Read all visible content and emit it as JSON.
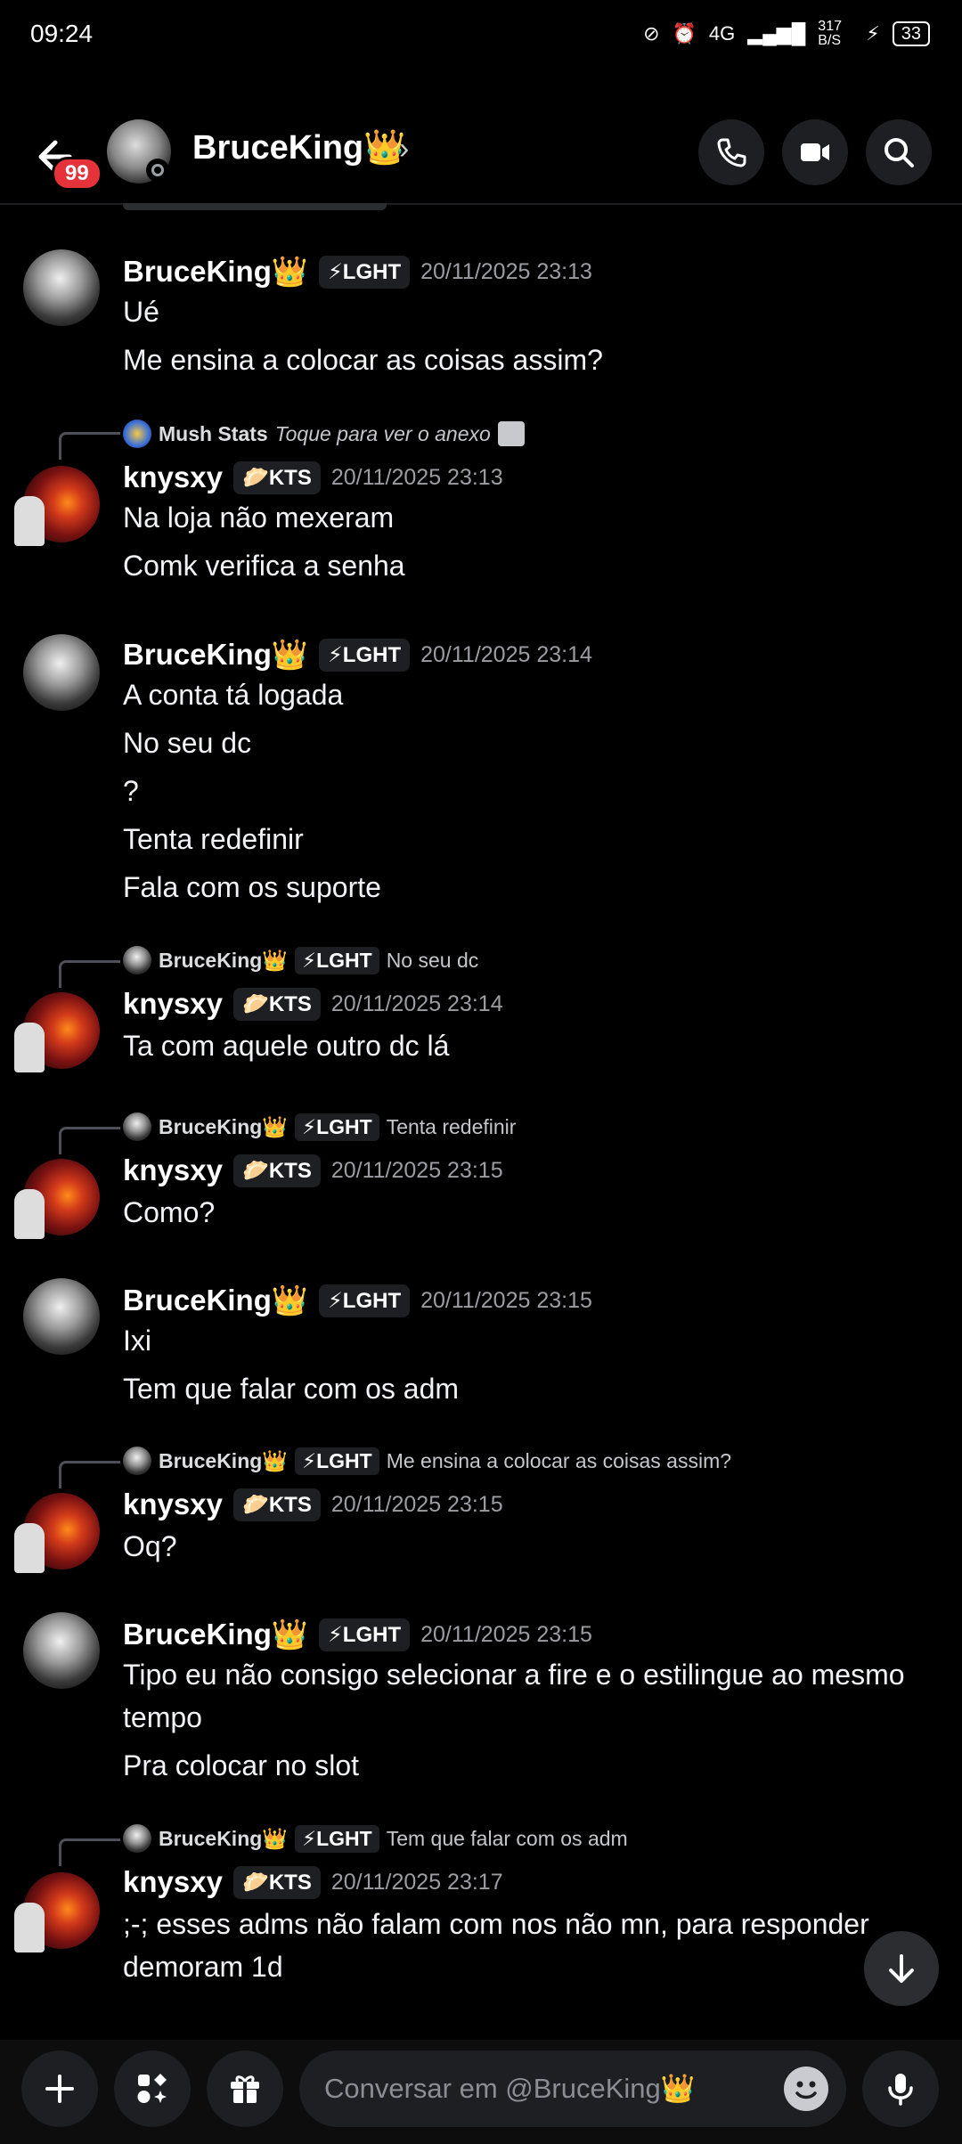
{
  "status_bar": {
    "time": "09:24",
    "signal": "4G",
    "speed": "317 B/S",
    "battery": "33"
  },
  "header": {
    "back_badge": "99",
    "name": "BruceKing👑",
    "chevron": "›"
  },
  "tags": {
    "bruce": "⚡LGHT",
    "knysxy": "🥟KTS"
  },
  "messages": [
    {
      "author": "BruceKing👑",
      "tag": "⚡LGHT",
      "timestamp": "20/11/2025 23:13",
      "lines": [
        "Ué",
        "Me ensina a colocar as coisas assim?"
      ]
    },
    {
      "reply": {
        "name": "Mush Stats",
        "text": "Toque para ver o anexo"
      },
      "author": "knysxy",
      "tag": "🥟KTS",
      "timestamp": "20/11/2025 23:13",
      "lines": [
        "Na loja não mexeram",
        "Comk verifica a senha"
      ]
    },
    {
      "author": "BruceKing👑",
      "tag": "⚡LGHT",
      "timestamp": "20/11/2025 23:14",
      "lines": [
        "A conta tá logada",
        "No seu dc",
        "?",
        "Tenta redefinir",
        "Fala com os suporte"
      ]
    },
    {
      "reply": {
        "name": "BruceKing👑",
        "tag": "⚡LGHT",
        "text": "No seu dc"
      },
      "author": "knysxy",
      "tag": "🥟KTS",
      "timestamp": "20/11/2025 23:14",
      "lines": [
        "Ta com aquele outro dc lá"
      ]
    },
    {
      "reply": {
        "name": "BruceKing👑",
        "tag": "⚡LGHT",
        "text": "Tenta redefinir"
      },
      "author": "knysxy",
      "tag": "🥟KTS",
      "timestamp": "20/11/2025 23:15",
      "lines": [
        "Como?"
      ]
    },
    {
      "author": "BruceKing👑",
      "tag": "⚡LGHT",
      "timestamp": "20/11/2025 23:15",
      "lines": [
        "Ixi",
        "Tem que falar com os adm"
      ]
    },
    {
      "reply": {
        "name": "BruceKing👑",
        "tag": "⚡LGHT",
        "text": "Me ensina a colocar as coisas assim?"
      },
      "author": "knysxy",
      "tag": "🥟KTS",
      "timestamp": "20/11/2025 23:15",
      "lines": [
        "Oq?"
      ]
    },
    {
      "author": "BruceKing👑",
      "tag": "⚡LGHT",
      "timestamp": "20/11/2025 23:15",
      "lines": [
        "Tipo eu não consigo selecionar a fire e o estilingue ao mesmo tempo",
        "Pra colocar no slot"
      ]
    },
    {
      "reply": {
        "name": "BruceKing👑",
        "tag": "⚡LGHT",
        "text": "Tem que falar com os adm"
      },
      "author": "knysxy",
      "tag": "🥟KTS",
      "timestamp": "20/11/2025 23:17",
      "lines": [
        ";-; esses adms não falam com nos não mn, para responder demoram 1d"
      ]
    }
  ],
  "composer": {
    "placeholder": "Conversar em @BruceKing👑"
  },
  "icons": {
    "back": "arrow-left-icon",
    "call": "phone-icon",
    "video": "video-icon",
    "search": "search-icon",
    "scroll_down": "arrow-down-icon",
    "add": "plus-icon",
    "apps": "apps-icon",
    "gift": "gift-icon",
    "emoji": "emoji-icon",
    "mic": "mic-icon"
  }
}
